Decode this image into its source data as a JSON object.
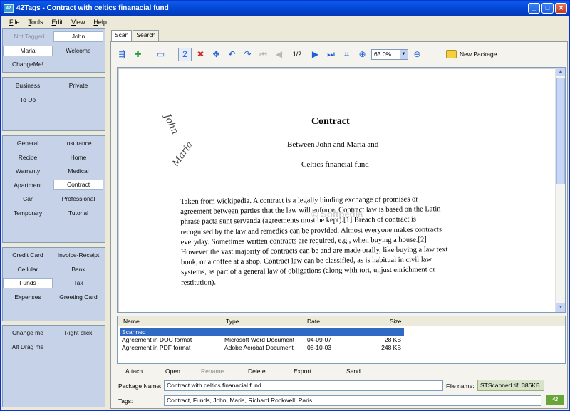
{
  "window": {
    "title": "42Tags - Contract with celtics finanacial fund",
    "app_icon": "42",
    "buttons": [
      "_",
      "□",
      "✕"
    ]
  },
  "menu": {
    "items": [
      {
        "u": "F",
        "rest": "ile"
      },
      {
        "u": "T",
        "rest": "ools"
      },
      {
        "u": "E",
        "rest": "dit"
      },
      {
        "u": "V",
        "rest": "iew"
      },
      {
        "u": "H",
        "rest": "elp"
      }
    ]
  },
  "tag_panels": {
    "p1": {
      "cells": [
        "Not Tagged",
        "John",
        "Maria",
        "Welcome",
        "ChangeMe!"
      ]
    },
    "p2": {
      "cells": [
        "Business",
        "Private",
        "To Do"
      ]
    },
    "p3": {
      "cells": [
        "General",
        "Insurance",
        "Recipe",
        "Home",
        "Warranty",
        "Medical",
        "Apartment",
        "Contract",
        "Car",
        "Professional",
        "Temporary",
        "Tutorial"
      ]
    },
    "p4": {
      "cells": [
        "Credit Card",
        "Invoice-Receipt",
        "Cellular",
        "Bank",
        "Funds",
        "Tax",
        "Expenses",
        "Greeting Card"
      ]
    },
    "p5": {
      "cells": [
        "Change me",
        "Right click",
        "Alt Drag me"
      ]
    }
  },
  "tabs": {
    "scan": "Scan",
    "search": "Search"
  },
  "toolbar": {
    "page": "1/2",
    "zoom": "63.0%",
    "new_package": "New Package"
  },
  "document": {
    "title": "Contract",
    "subtitle1": "Between John and Maria and",
    "subtitle2": "Celtics financial fund",
    "handwriting_john": "John",
    "handwriting_maria": "Maria",
    "watermark": "© Softpedia",
    "body_lines": [
      "Taken from wickipedia. A contract is a legally binding exchange of promises or",
      "agreement between parties that the law will enforce. Contract law is based on the Latin",
      "phrase pacta sunt servanda (agreements must be kept).[1] Breach of contract is",
      "recognised by the law and remedies can be provided. Almost everyone makes contracts",
      "everyday. Sometimes written contracts are required, e.g., when buying a house.[2]",
      "However the vast majority of contracts can be and are made orally, like buying a law text",
      "book, or a coffee at a shop. Contract law can be classified, as is habitual in civil law",
      "systems, as part of a general law of obligations (along with tort, unjust enrichment or",
      "restitution)."
    ]
  },
  "file_list": {
    "headers": {
      "name": "Name",
      "type": "Type",
      "date": "Date",
      "size": "Size"
    },
    "rows": [
      {
        "name": "Scanned",
        "type": "",
        "date": "",
        "size": ""
      },
      {
        "name": "Agreement in DOC format",
        "type": "Microsoft Word Document",
        "date": "04-09-07",
        "size": "28 KB"
      },
      {
        "name": "Agreement in PDF format",
        "type": "Adobe Acrobat Document",
        "date": "08-10-03",
        "size": "248 KB"
      }
    ]
  },
  "actions": {
    "attach": "Attach",
    "open": "Open",
    "rename": "Rename",
    "delete": "Delete",
    "export": "Export",
    "send": "Send"
  },
  "package": {
    "name_label": "Package Name:",
    "name_value": "Contract with celtics finanacial fund",
    "file_label": "File name:",
    "file_value": "STScanned.tif, 386KB",
    "tags_label": "Tags:",
    "tags_value": "Contract, Funds, John, Maria, Richard Rockwell, Paris"
  },
  "colors": {
    "titlebar": "#0347d6",
    "tag_panel": "#c5d2e8",
    "selection": "#316ac5"
  }
}
